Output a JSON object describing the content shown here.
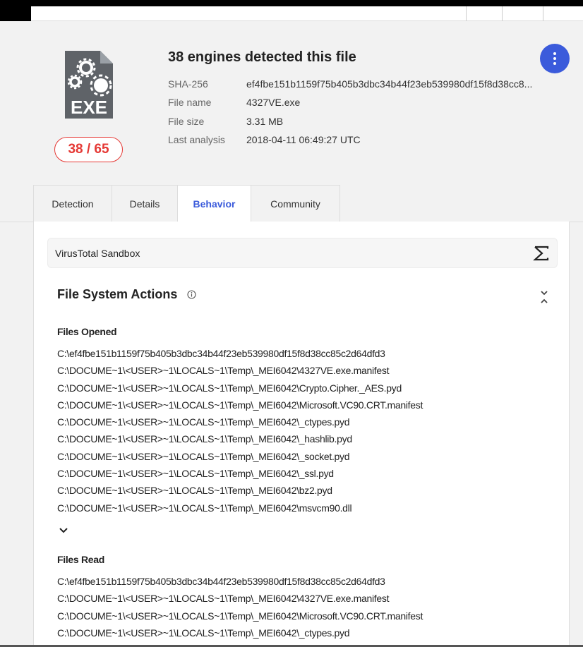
{
  "header": {
    "title": "38 engines detected this file",
    "score": "38 / 65",
    "file_type_label": "EXE",
    "meta": [
      {
        "label": "SHA-256",
        "value": "ef4fbe151b1159f75b405b3dbc34b44f23eb539980df15f8d38cc8..."
      },
      {
        "label": "File name",
        "value": "4327VE.exe"
      },
      {
        "label": "File size",
        "value": "3.31 MB"
      },
      {
        "label": "Last analysis",
        "value": "2018-04-11 06:49:27 UTC"
      }
    ],
    "menu_icon": "more-vertical-icon",
    "accent_color": "#3b5bdb",
    "alert_color": "#e53935"
  },
  "tabs": [
    {
      "label": "Detection",
      "active": false
    },
    {
      "label": "Details",
      "active": false
    },
    {
      "label": "Behavior",
      "active": true
    },
    {
      "label": "Community",
      "active": false
    }
  ],
  "sandbox": {
    "label": "VirusTotal Sandbox",
    "icon": "sigma-icon"
  },
  "file_system_actions": {
    "title": "File System Actions",
    "info_icon": "info-icon",
    "collapse_icon": "collapse-chevrons-icon",
    "files_opened": {
      "title": "Files Opened",
      "items": [
        "C:\\ef4fbe151b1159f75b405b3dbc34b44f23eb539980df15f8d38cc85c2d64dfd3",
        "C:\\DOCUME~1\\<USER>~1\\LOCALS~1\\Temp\\_MEI6042\\4327VE.exe.manifest",
        "C:\\DOCUME~1\\<USER>~1\\LOCALS~1\\Temp\\_MEI6042\\Crypto.Cipher._AES.pyd",
        "C:\\DOCUME~1\\<USER>~1\\LOCALS~1\\Temp\\_MEI6042\\Microsoft.VC90.CRT.manifest",
        "C:\\DOCUME~1\\<USER>~1\\LOCALS~1\\Temp\\_MEI6042\\_ctypes.pyd",
        "C:\\DOCUME~1\\<USER>~1\\LOCALS~1\\Temp\\_MEI6042\\_hashlib.pyd",
        "C:\\DOCUME~1\\<USER>~1\\LOCALS~1\\Temp\\_MEI6042\\_socket.pyd",
        "C:\\DOCUME~1\\<USER>~1\\LOCALS~1\\Temp\\_MEI6042\\_ssl.pyd",
        "C:\\DOCUME~1\\<USER>~1\\LOCALS~1\\Temp\\_MEI6042\\bz2.pyd",
        "C:\\DOCUME~1\\<USER>~1\\LOCALS~1\\Temp\\_MEI6042\\msvcm90.dll"
      ],
      "expand_icon": "chevron-down-icon"
    },
    "files_read": {
      "title": "Files Read",
      "items": [
        "C:\\ef4fbe151b1159f75b405b3dbc34b44f23eb539980df15f8d38cc85c2d64dfd3",
        "C:\\DOCUME~1\\<USER>~1\\LOCALS~1\\Temp\\_MEI6042\\4327VE.exe.manifest",
        "C:\\DOCUME~1\\<USER>~1\\LOCALS~1\\Temp\\_MEI6042\\Microsoft.VC90.CRT.manifest",
        "C:\\DOCUME~1\\<USER>~1\\LOCALS~1\\Temp\\_MEI6042\\_ctypes.pyd"
      ]
    }
  }
}
